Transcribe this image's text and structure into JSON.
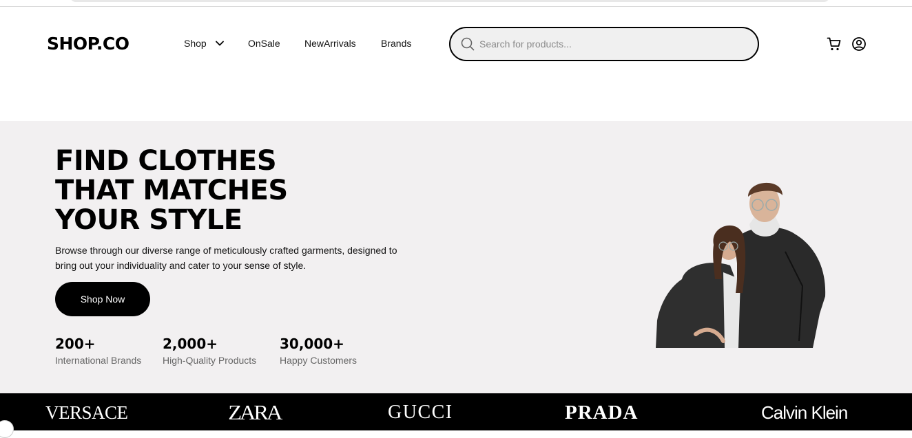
{
  "header": {
    "logo": "SHOP.CO",
    "nav": {
      "shop": "Shop",
      "onsale": "OnSale",
      "new_arrivals": "NewArrivals",
      "brands": "Brands"
    },
    "search": {
      "placeholder": "Search for products..."
    }
  },
  "hero": {
    "title_lines": [
      "FIND CLOTHES",
      "THAT MATCHES",
      "YOUR STYLE"
    ],
    "description": "Browse through our diverse range of meticulously crafted garments, designed to bring out your individuality and cater to your sense of style.",
    "cta": "Shop Now",
    "stats": [
      {
        "number": "200+",
        "label": "International Brands"
      },
      {
        "number": "2,000+",
        "label": "High-Quality Products"
      },
      {
        "number": "30,000+",
        "label": "Happy Customers"
      }
    ]
  },
  "brands": [
    "VERSACE",
    "ZARA",
    "GUCCI",
    "PRADA",
    "Calvin Klein"
  ],
  "colors": {
    "hero_bg": "#f2f0f1",
    "brand_bar": "#000000",
    "search_bg": "#f0f0f0",
    "muted_text": "#666666"
  },
  "icons": [
    "search-icon",
    "chevron-down-icon",
    "cart-icon",
    "user-icon"
  ]
}
